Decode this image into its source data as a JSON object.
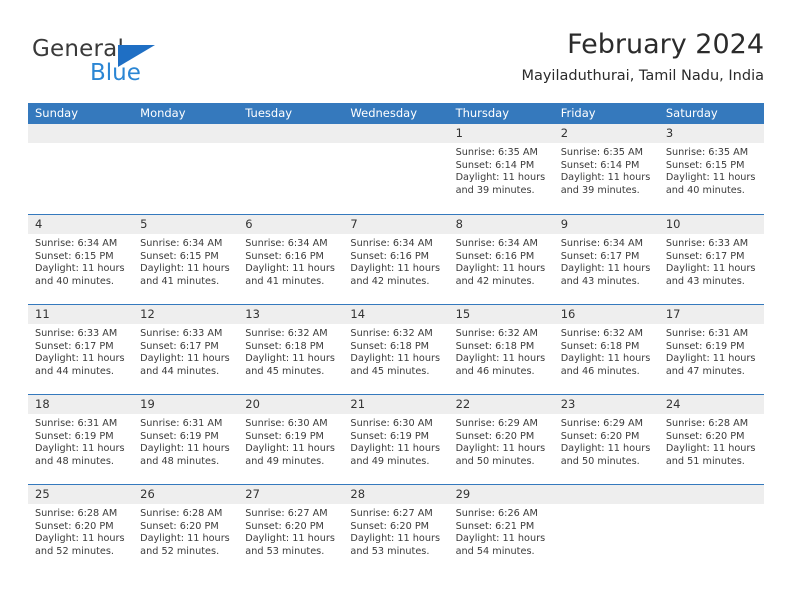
{
  "brand": {
    "name_part1": "General",
    "name_part2": "Blue",
    "triangle_color": "#1f6fc4",
    "blue_color": "#2b86d4"
  },
  "header": {
    "month_title": "February 2024",
    "location": "Mayiladuthurai, Tamil Nadu, India"
  },
  "theme": {
    "header_blue": "#3579bd",
    "day_band_gray": "#eeeeee"
  },
  "weekdays": [
    "Sunday",
    "Monday",
    "Tuesday",
    "Wednesday",
    "Thursday",
    "Friday",
    "Saturday"
  ],
  "weeks": [
    [
      {
        "day": "",
        "sunrise": "",
        "sunset": "",
        "daylight_line1": "",
        "daylight_line2": ""
      },
      {
        "day": "",
        "sunrise": "",
        "sunset": "",
        "daylight_line1": "",
        "daylight_line2": ""
      },
      {
        "day": "",
        "sunrise": "",
        "sunset": "",
        "daylight_line1": "",
        "daylight_line2": ""
      },
      {
        "day": "",
        "sunrise": "",
        "sunset": "",
        "daylight_line1": "",
        "daylight_line2": ""
      },
      {
        "day": "1",
        "sunrise": "Sunrise: 6:35 AM",
        "sunset": "Sunset: 6:14 PM",
        "daylight_line1": "Daylight: 11 hours",
        "daylight_line2": "and 39 minutes."
      },
      {
        "day": "2",
        "sunrise": "Sunrise: 6:35 AM",
        "sunset": "Sunset: 6:14 PM",
        "daylight_line1": "Daylight: 11 hours",
        "daylight_line2": "and 39 minutes."
      },
      {
        "day": "3",
        "sunrise": "Sunrise: 6:35 AM",
        "sunset": "Sunset: 6:15 PM",
        "daylight_line1": "Daylight: 11 hours",
        "daylight_line2": "and 40 minutes."
      }
    ],
    [
      {
        "day": "4",
        "sunrise": "Sunrise: 6:34 AM",
        "sunset": "Sunset: 6:15 PM",
        "daylight_line1": "Daylight: 11 hours",
        "daylight_line2": "and 40 minutes."
      },
      {
        "day": "5",
        "sunrise": "Sunrise: 6:34 AM",
        "sunset": "Sunset: 6:15 PM",
        "daylight_line1": "Daylight: 11 hours",
        "daylight_line2": "and 41 minutes."
      },
      {
        "day": "6",
        "sunrise": "Sunrise: 6:34 AM",
        "sunset": "Sunset: 6:16 PM",
        "daylight_line1": "Daylight: 11 hours",
        "daylight_line2": "and 41 minutes."
      },
      {
        "day": "7",
        "sunrise": "Sunrise: 6:34 AM",
        "sunset": "Sunset: 6:16 PM",
        "daylight_line1": "Daylight: 11 hours",
        "daylight_line2": "and 42 minutes."
      },
      {
        "day": "8",
        "sunrise": "Sunrise: 6:34 AM",
        "sunset": "Sunset: 6:16 PM",
        "daylight_line1": "Daylight: 11 hours",
        "daylight_line2": "and 42 minutes."
      },
      {
        "day": "9",
        "sunrise": "Sunrise: 6:34 AM",
        "sunset": "Sunset: 6:17 PM",
        "daylight_line1": "Daylight: 11 hours",
        "daylight_line2": "and 43 minutes."
      },
      {
        "day": "10",
        "sunrise": "Sunrise: 6:33 AM",
        "sunset": "Sunset: 6:17 PM",
        "daylight_line1": "Daylight: 11 hours",
        "daylight_line2": "and 43 minutes."
      }
    ],
    [
      {
        "day": "11",
        "sunrise": "Sunrise: 6:33 AM",
        "sunset": "Sunset: 6:17 PM",
        "daylight_line1": "Daylight: 11 hours",
        "daylight_line2": "and 44 minutes."
      },
      {
        "day": "12",
        "sunrise": "Sunrise: 6:33 AM",
        "sunset": "Sunset: 6:17 PM",
        "daylight_line1": "Daylight: 11 hours",
        "daylight_line2": "and 44 minutes."
      },
      {
        "day": "13",
        "sunrise": "Sunrise: 6:32 AM",
        "sunset": "Sunset: 6:18 PM",
        "daylight_line1": "Daylight: 11 hours",
        "daylight_line2": "and 45 minutes."
      },
      {
        "day": "14",
        "sunrise": "Sunrise: 6:32 AM",
        "sunset": "Sunset: 6:18 PM",
        "daylight_line1": "Daylight: 11 hours",
        "daylight_line2": "and 45 minutes."
      },
      {
        "day": "15",
        "sunrise": "Sunrise: 6:32 AM",
        "sunset": "Sunset: 6:18 PM",
        "daylight_line1": "Daylight: 11 hours",
        "daylight_line2": "and 46 minutes."
      },
      {
        "day": "16",
        "sunrise": "Sunrise: 6:32 AM",
        "sunset": "Sunset: 6:18 PM",
        "daylight_line1": "Daylight: 11 hours",
        "daylight_line2": "and 46 minutes."
      },
      {
        "day": "17",
        "sunrise": "Sunrise: 6:31 AM",
        "sunset": "Sunset: 6:19 PM",
        "daylight_line1": "Daylight: 11 hours",
        "daylight_line2": "and 47 minutes."
      }
    ],
    [
      {
        "day": "18",
        "sunrise": "Sunrise: 6:31 AM",
        "sunset": "Sunset: 6:19 PM",
        "daylight_line1": "Daylight: 11 hours",
        "daylight_line2": "and 48 minutes."
      },
      {
        "day": "19",
        "sunrise": "Sunrise: 6:31 AM",
        "sunset": "Sunset: 6:19 PM",
        "daylight_line1": "Daylight: 11 hours",
        "daylight_line2": "and 48 minutes."
      },
      {
        "day": "20",
        "sunrise": "Sunrise: 6:30 AM",
        "sunset": "Sunset: 6:19 PM",
        "daylight_line1": "Daylight: 11 hours",
        "daylight_line2": "and 49 minutes."
      },
      {
        "day": "21",
        "sunrise": "Sunrise: 6:30 AM",
        "sunset": "Sunset: 6:19 PM",
        "daylight_line1": "Daylight: 11 hours",
        "daylight_line2": "and 49 minutes."
      },
      {
        "day": "22",
        "sunrise": "Sunrise: 6:29 AM",
        "sunset": "Sunset: 6:20 PM",
        "daylight_line1": "Daylight: 11 hours",
        "daylight_line2": "and 50 minutes."
      },
      {
        "day": "23",
        "sunrise": "Sunrise: 6:29 AM",
        "sunset": "Sunset: 6:20 PM",
        "daylight_line1": "Daylight: 11 hours",
        "daylight_line2": "and 50 minutes."
      },
      {
        "day": "24",
        "sunrise": "Sunrise: 6:28 AM",
        "sunset": "Sunset: 6:20 PM",
        "daylight_line1": "Daylight: 11 hours",
        "daylight_line2": "and 51 minutes."
      }
    ],
    [
      {
        "day": "25",
        "sunrise": "Sunrise: 6:28 AM",
        "sunset": "Sunset: 6:20 PM",
        "daylight_line1": "Daylight: 11 hours",
        "daylight_line2": "and 52 minutes."
      },
      {
        "day": "26",
        "sunrise": "Sunrise: 6:28 AM",
        "sunset": "Sunset: 6:20 PM",
        "daylight_line1": "Daylight: 11 hours",
        "daylight_line2": "and 52 minutes."
      },
      {
        "day": "27",
        "sunrise": "Sunrise: 6:27 AM",
        "sunset": "Sunset: 6:20 PM",
        "daylight_line1": "Daylight: 11 hours",
        "daylight_line2": "and 53 minutes."
      },
      {
        "day": "28",
        "sunrise": "Sunrise: 6:27 AM",
        "sunset": "Sunset: 6:20 PM",
        "daylight_line1": "Daylight: 11 hours",
        "daylight_line2": "and 53 minutes."
      },
      {
        "day": "29",
        "sunrise": "Sunrise: 6:26 AM",
        "sunset": "Sunset: 6:21 PM",
        "daylight_line1": "Daylight: 11 hours",
        "daylight_line2": "and 54 minutes."
      },
      {
        "day": "",
        "sunrise": "",
        "sunset": "",
        "daylight_line1": "",
        "daylight_line2": ""
      },
      {
        "day": "",
        "sunrise": "",
        "sunset": "",
        "daylight_line1": "",
        "daylight_line2": ""
      }
    ]
  ]
}
